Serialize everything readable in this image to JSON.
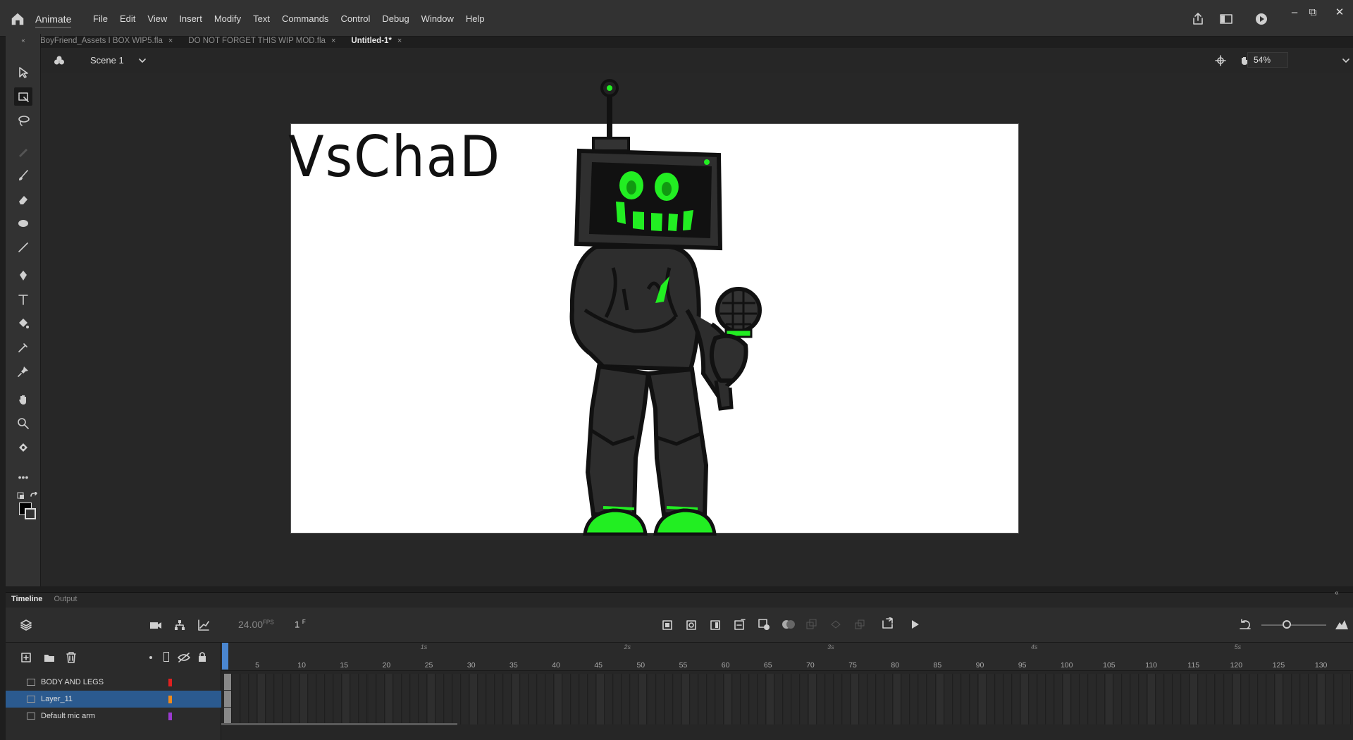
{
  "app": {
    "name": "Animate"
  },
  "menu": [
    "File",
    "Edit",
    "View",
    "Insert",
    "Modify",
    "Text",
    "Commands",
    "Control",
    "Debug",
    "Window",
    "Help"
  ],
  "tabs": [
    {
      "label": "BoyFriend_Assets I BOX WIP5.fla",
      "active": false
    },
    {
      "label": "DO NOT FORGET THIS WIP MOD.fla",
      "active": false
    },
    {
      "label": "Untitled-1*",
      "active": true
    }
  ],
  "scene": {
    "label": "Scene 1",
    "zoom": "54%"
  },
  "stage": {
    "text": "VsChaD",
    "background": "#ffffff"
  },
  "timeline": {
    "tabs": [
      "Timeline",
      "Output"
    ],
    "fps": "24.00",
    "fps_unit": "FPS",
    "frame": "1",
    "frame_unit": "F",
    "layers": [
      {
        "name": "BODY AND LEGS",
        "color": "#e02020",
        "selected": false
      },
      {
        "name": "Layer_11",
        "color": "#f08a1a",
        "selected": true
      },
      {
        "name": "Default mic arm",
        "color": "#9b3ad0",
        "selected": false
      }
    ],
    "frame_numbers": [
      "5",
      "10",
      "15",
      "20",
      "25",
      "30",
      "35",
      "40",
      "45",
      "50",
      "55",
      "60",
      "65",
      "70",
      "75",
      "80",
      "85",
      "90",
      "95",
      "100",
      "105",
      "110",
      "115",
      "120",
      "125",
      "130"
    ],
    "seconds": [
      "1s",
      "2s",
      "3s",
      "4s",
      "5s"
    ]
  },
  "colors": {
    "accent": "#2b5a8f",
    "chad_green": "#22ee22",
    "chad_body": "#2d2d2d"
  }
}
